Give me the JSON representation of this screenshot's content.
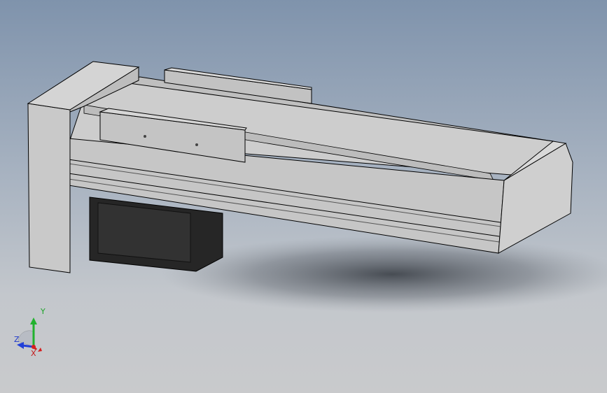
{
  "viewport": {
    "background_top": "#7f93ac",
    "background_bottom": "#c9cacc"
  },
  "model": {
    "body_color": "#c8c8c8",
    "edge_color": "#000000",
    "motor_color": "#2a2a2a"
  },
  "triad": {
    "x_label": "X",
    "y_label": "Y",
    "z_label": "Z",
    "x_color": "#d42020",
    "y_color": "#22b22e",
    "z_color": "#2240d8"
  }
}
